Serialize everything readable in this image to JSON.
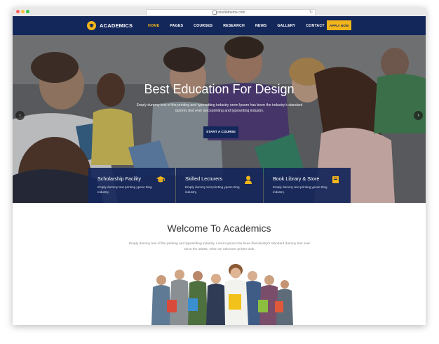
{
  "browser": {
    "url": "colorlibtheme.com"
  },
  "nav": {
    "logo_text": "ACADEMICS",
    "items": [
      "HOME",
      "PAGES",
      "COURSES",
      "RESEARCH",
      "NEWS",
      "GALLERY",
      "CONTACT"
    ],
    "active": "HOME",
    "apply_label": "APPLY NOW"
  },
  "hero": {
    "title": "Best Education For Design",
    "subtitle": "Emply dummy text of the printing and typesetting industry orem Ipsum has been the industry's standard dummy text ever sinceprinting and typesetting industry.",
    "button": "START A COURSE",
    "prev_icon": "chevron-left-icon",
    "next_icon": "chevron-right-icon"
  },
  "features": [
    {
      "title": "Scholarship Facility",
      "text": "Emply dummy text printing ypese tting industry.",
      "icon": "graduation-cap-icon"
    },
    {
      "title": "Skilled Lecturers",
      "text": "Emply dummy text printing ypese tting industry.",
      "icon": "user-icon"
    },
    {
      "title": "Book Library & Store",
      "text": "Emply dummy text printing ypese tting industry.",
      "icon": "book-icon"
    }
  ],
  "welcome": {
    "title": "Welcome To Academics",
    "text": "Emply dummy text of the printing and typesetting industry. Lorem Ipsum has been theindustry's standard dummy text ever since the 1500s, when an unknown printer took."
  },
  "colors": {
    "navy": "#14275a",
    "accent": "#f3b61a"
  }
}
